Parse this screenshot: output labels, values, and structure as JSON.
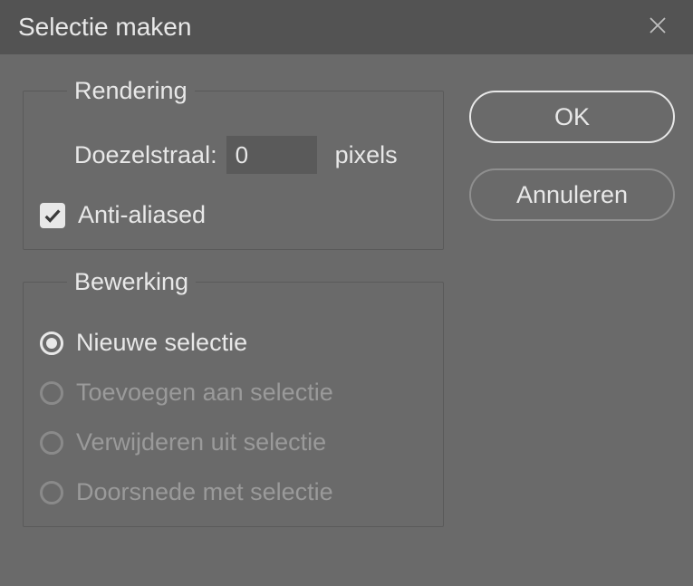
{
  "title": "Selectie maken",
  "rendering": {
    "legend": "Rendering",
    "feather_label": "Doezelstraal:",
    "feather_value": "0",
    "feather_suffix": "pixels",
    "antialiased_label": "Anti-aliased",
    "antialiased_checked": true
  },
  "operation": {
    "legend": "Bewerking",
    "options": [
      {
        "label": "Nieuwe selectie",
        "selected": true,
        "enabled": true
      },
      {
        "label": "Toevoegen aan selectie",
        "selected": false,
        "enabled": false
      },
      {
        "label": "Verwijderen uit selectie",
        "selected": false,
        "enabled": false
      },
      {
        "label": "Doorsnede met selectie",
        "selected": false,
        "enabled": false
      }
    ]
  },
  "buttons": {
    "ok": "OK",
    "cancel": "Annuleren"
  }
}
